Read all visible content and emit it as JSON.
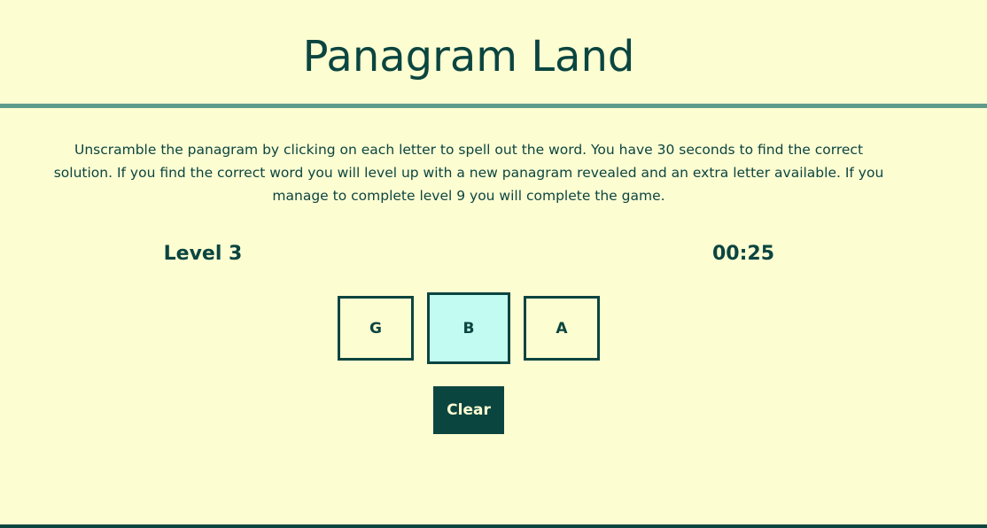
{
  "header": {
    "title": "Panagram Land"
  },
  "instructions": {
    "text": "Unscramble the panagram by clicking on each letter to spell out the word. You have 30 seconds to find the correct solution. If you find the correct word you will level up with a new panagram revealed and an extra letter available. If you manage to complete level 9 you will complete the game."
  },
  "status": {
    "level_label": "Level 3",
    "timer": "00:25"
  },
  "tiles": [
    {
      "letter": "G",
      "selected": false
    },
    {
      "letter": "B",
      "selected": true
    },
    {
      "letter": "A",
      "selected": false
    }
  ],
  "controls": {
    "clear_label": "Clear"
  },
  "colors": {
    "background": "#fdfdd2",
    "primary": "#0b4540",
    "rule": "#5f9b8b",
    "selected_tile": "#c2fbf2"
  }
}
